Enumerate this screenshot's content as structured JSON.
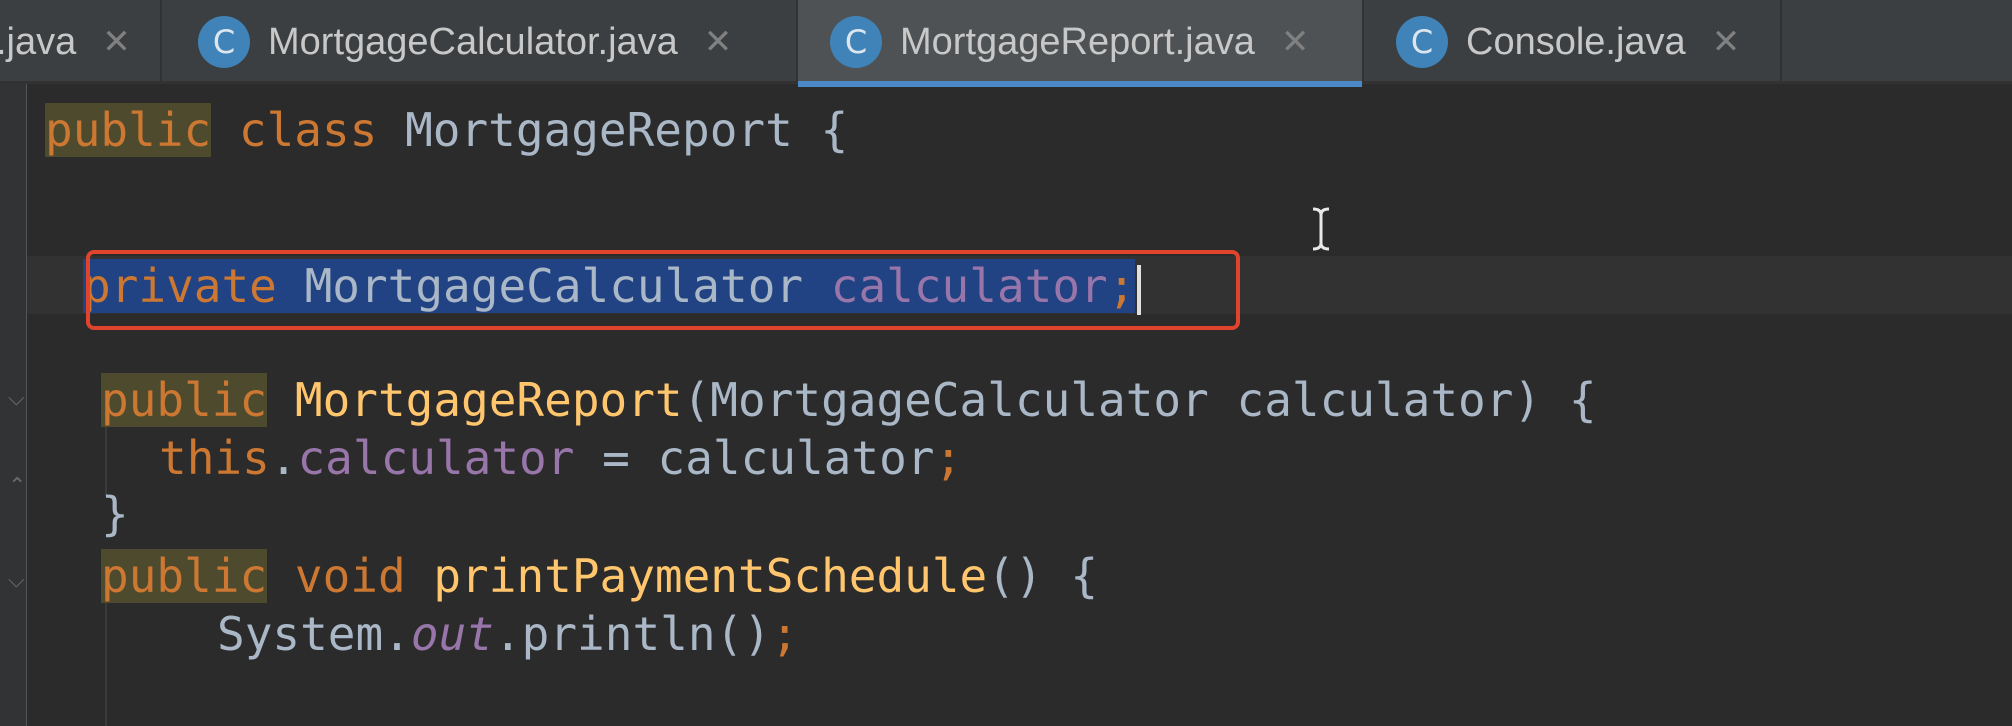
{
  "tabs": [
    {
      "label": ".java",
      "icon": "class-c-icon",
      "active": false
    },
    {
      "label": "MortgageCalculator.java",
      "icon": "class-c-icon",
      "active": false
    },
    {
      "label": "MortgageReport.java",
      "icon": "class-c-icon",
      "active": true
    },
    {
      "label": "Console.java",
      "icon": "class-c-icon",
      "active": false
    }
  ],
  "icons": {
    "class_glyph": "C",
    "close_glyph": "✕"
  },
  "code": {
    "line1": {
      "kw_public": "public",
      "kw_class": "class",
      "name": "MortgageReport",
      "brace": "{"
    },
    "line2": {
      "kw_private": "private",
      "type": "MortgageCalculator",
      "field": "calculator",
      "semi": ";"
    },
    "line3": {
      "kw_public": "public",
      "ctor": "MortgageReport",
      "params": "(MortgageCalculator calculator) {"
    },
    "line4": {
      "kw_this": "this",
      "dot": ".",
      "field": "calculator",
      "assign": " = calculator",
      "semi": ";"
    },
    "line5": {
      "brace": "}"
    },
    "line6": {
      "kw_public": "public",
      "kw_void": "void",
      "method": "printPaymentSchedule",
      "rest": "() {"
    },
    "line7": {
      "system": "System.",
      "out": "out",
      "call": ".println()",
      "semi": ";"
    }
  },
  "colors": {
    "background": "#2b2b2b",
    "keyword": "#cc7832",
    "method": "#ffc66d",
    "field": "#9876aa",
    "selection": "#214283",
    "highlight_border": "#e0442c",
    "tab_accent": "#4a88c7"
  }
}
